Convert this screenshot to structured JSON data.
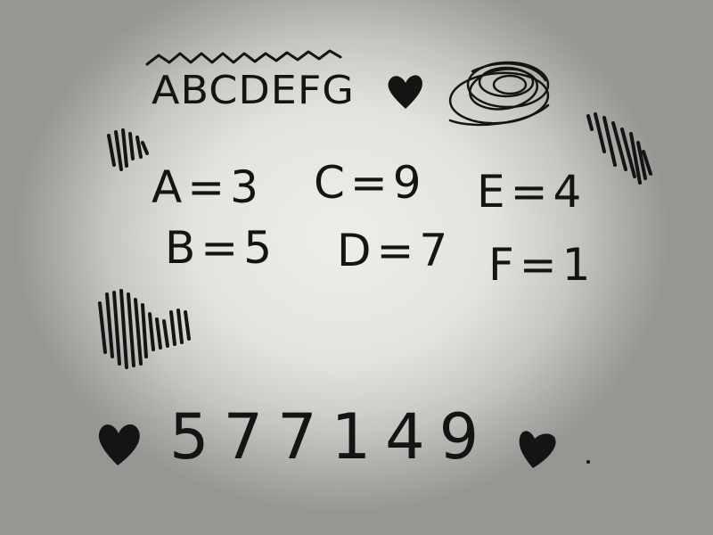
{
  "paper": {
    "alphabet": "ABCDEFG",
    "equations": [
      {
        "letter": "A",
        "text": "A=3"
      },
      {
        "letter": "C",
        "text": "C=9"
      },
      {
        "letter": "E",
        "text": "E=4"
      },
      {
        "letter": "B",
        "text": "B=5"
      },
      {
        "letter": "D",
        "text": "D=7"
      },
      {
        "letter": "F",
        "text": "F=1"
      }
    ],
    "code": "577149"
  },
  "colors": {
    "ink": "#141414",
    "paper": "#e2e4de"
  },
  "icons": [
    "wavy-line-icon",
    "heart-icon",
    "scribble-icon",
    "scribble-blot-icon",
    "heart-icon",
    "heart-icon"
  ]
}
